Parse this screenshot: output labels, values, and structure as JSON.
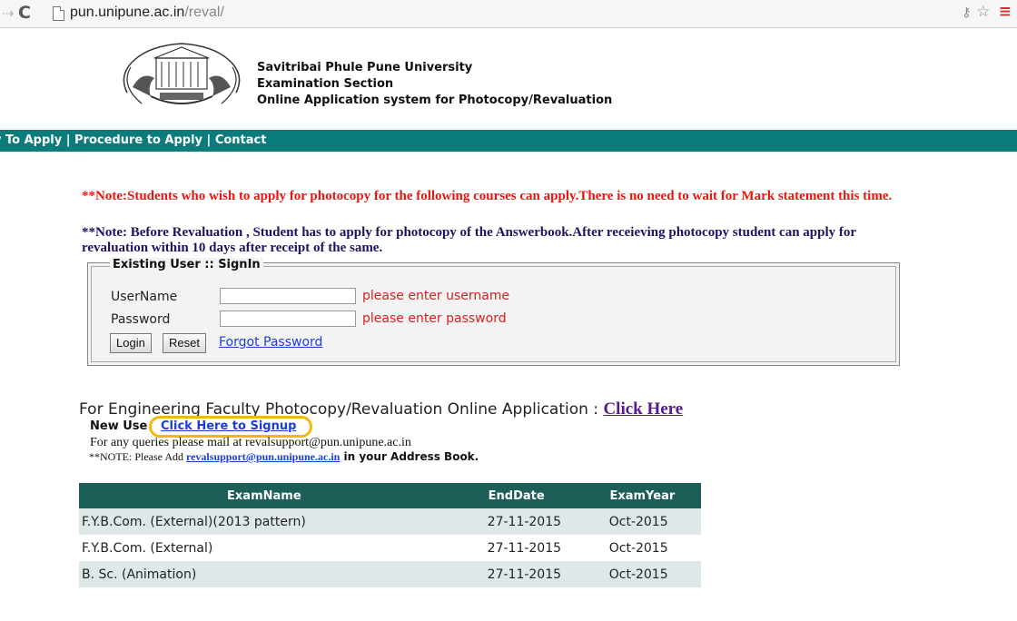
{
  "browser": {
    "url_host": "pun.unipune.ac.in",
    "url_path": "/reval/"
  },
  "header": {
    "line1": "Savitribai Phule Pune University",
    "line2": "Examination Section",
    "line3": "Online Application system for Photocopy/Revaluation"
  },
  "nav": {
    "how_to_apply": "v To Apply",
    "sep1": " | ",
    "procedure": "Procedure to Apply",
    "sep2": " | ",
    "contact": "Contact"
  },
  "notes": {
    "note1": "**Note:Students who wish to apply for photocopy for the following courses can apply.There is no need to wait for Mark statement this time.",
    "note2": "**Note: Before Revaluation , Student has to apply for photocopy of the Answerbook.After receieving photocopy student can apply for revaluation within 10 days after receipt of the same."
  },
  "login": {
    "legend": "Existing User :: SignIn",
    "username_label": "UserName",
    "password_label": "Password",
    "username_value": "",
    "password_value": "",
    "username_error": "please enter username",
    "password_error": "please enter password",
    "login_button": "Login",
    "reset_button": "Reset",
    "forgot_link": "Forgot Password"
  },
  "engineering": {
    "text": "For Engineering Faculty Photocopy/Revaluation Online Application : ",
    "link": "Click Here"
  },
  "signup": {
    "new_user": "New Use",
    "link": "Click Here to Signup",
    "highlight_color": "#f2b80f"
  },
  "support": {
    "queries": "For any queries please mail at revalsupport@pun.unipune.ac.in",
    "note_prefix": "**NOTE: Please Add ",
    "email_link": "revalsupport@pun.unipune.ac.in",
    "note_suffix": " in your Address Book."
  },
  "exams": {
    "headers": [
      "ExamName",
      "EndDate",
      "ExamYear"
    ],
    "rows": [
      {
        "name": "F.Y.B.Com. (External)(2013 pattern)",
        "end": "27-11-2015",
        "year": "Oct-2015"
      },
      {
        "name": "F.Y.B.Com. (External)",
        "end": "27-11-2015",
        "year": "Oct-2015"
      },
      {
        "name": "B. Sc. (Animation)",
        "end": "27-11-2015",
        "year": "Oct-2015"
      }
    ]
  },
  "colors": {
    "nav_bar": "#0b7b7b",
    "table_header": "#1d5f58",
    "note_red": "#e8160e",
    "note_navy": "#1b1464"
  }
}
